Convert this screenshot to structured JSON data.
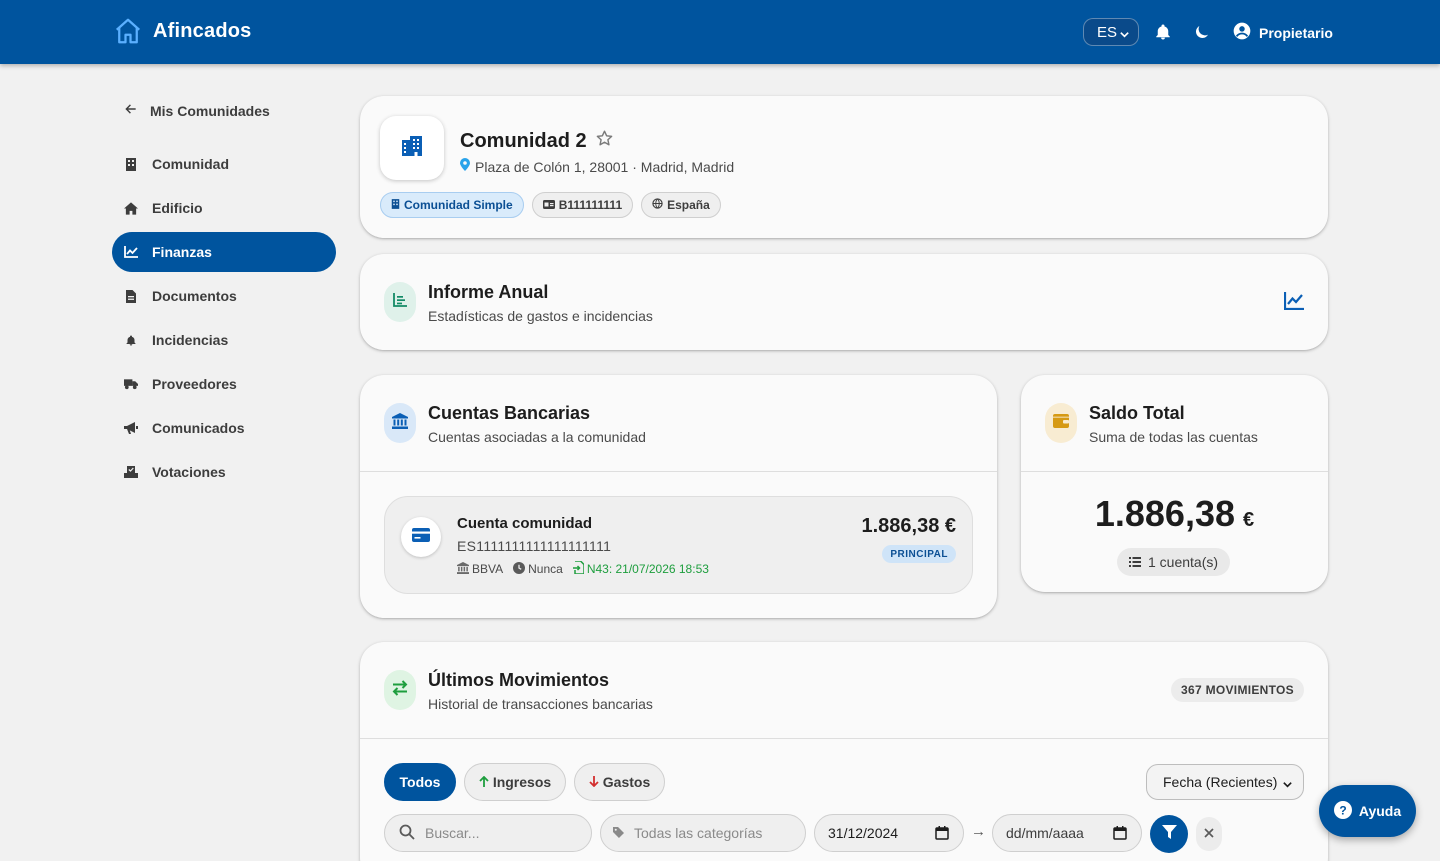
{
  "app": {
    "name": "Afincados"
  },
  "topbar": {
    "language": "ES",
    "user_label": "Propietario"
  },
  "sidebar": {
    "back_label": "Mis Comunidades",
    "items": [
      {
        "label": "Comunidad",
        "icon": "building-icon",
        "active": false
      },
      {
        "label": "Edificio",
        "icon": "home-icon",
        "active": false
      },
      {
        "label": "Finanzas",
        "icon": "chart-line-icon",
        "active": true
      },
      {
        "label": "Documentos",
        "icon": "document-icon",
        "active": false
      },
      {
        "label": "Incidencias",
        "icon": "bell-icon",
        "active": false
      },
      {
        "label": "Proveedores",
        "icon": "truck-icon",
        "active": false
      },
      {
        "label": "Comunicados",
        "icon": "megaphone-icon",
        "active": false
      },
      {
        "label": "Votaciones",
        "icon": "ballot-icon",
        "active": false
      }
    ]
  },
  "community": {
    "name": "Comunidad 2",
    "address": "Plaza de Colón 1, 28001 · Madrid, Madrid",
    "chips": {
      "type": "Comunidad Simple",
      "cif": "B111111111",
      "country": "España"
    }
  },
  "annual_report": {
    "title": "Informe Anual",
    "subtitle": "Estadísticas de gastos e incidencias"
  },
  "accounts": {
    "title": "Cuentas Bancarias",
    "subtitle": "Cuentas asociadas a la comunidad",
    "items": [
      {
        "name": "Cuenta comunidad",
        "iban": "ES1111111111111111111",
        "balance": "1.886,38 €",
        "badge": "PRINCIPAL",
        "bank": "BBVA",
        "sync": "Nunca",
        "n43": "N43: 21/07/2026 18:53"
      }
    ]
  },
  "total_balance": {
    "title": "Saldo Total",
    "subtitle": "Suma de todas las cuentas",
    "amount": "1.886,38",
    "currency": "€",
    "count_label": "1 cuenta(s)"
  },
  "movements": {
    "title": "Últimos Movimientos",
    "subtitle": "Historial de transacciones bancarias",
    "count_badge": "367 MOVIMIENTOS",
    "filters": {
      "all": "Todos",
      "income": "Ingresos",
      "expenses": "Gastos"
    },
    "sort_selected": "Fecha (Recientes)",
    "search_placeholder": "Buscar...",
    "category_placeholder": "Todas las categorías",
    "date_from": "31/12/2024",
    "date_to_placeholder": "dd/mm/aaaa",
    "arrow": "→"
  },
  "help": {
    "label": "Ayuda"
  },
  "colors": {
    "primary": "#00549e",
    "background": "#f1f1f1",
    "card": "#fafafa",
    "income": "#1e9e3e",
    "expense": "#d32f2f",
    "n43": "#1e9e3e"
  }
}
